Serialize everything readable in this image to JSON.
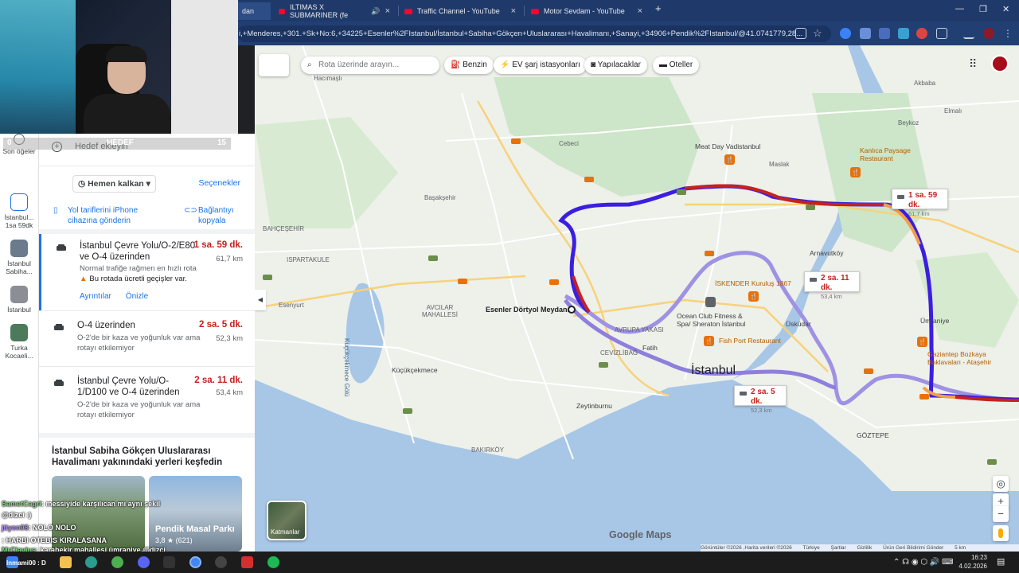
{
  "browser": {
    "tabs": [
      {
        "title": "ILTIMAS X SUBMARINER (fe"
      },
      {
        "title": "Traffic Channel - YouTube"
      },
      {
        "title": "Motor Sevdam - YouTube"
      }
    ],
    "partial_tab": "dan",
    "new_tab": "+",
    "url": "i,+Menderes,+301.+Sk+No:6,+34225+Esenler%2FIstanbul/İstanbul+Sabiha+Gökçen+Uluslararası+Havalimanı,+Sanayi,+34906+Pendik%2FIstanbul/@41.0741779,28..."
  },
  "webcam_bar": {
    "left": "0",
    "center": "HEDEF",
    "right": "15"
  },
  "rail": {
    "items": [
      {
        "label": "Son öğeler"
      },
      {
        "label": "İstanbul... 1sa 59dk"
      },
      {
        "label": "İstanbul Sabiha..."
      },
      {
        "label": "İstanbul"
      },
      {
        "label": "Turka Kocaeli..."
      }
    ]
  },
  "panel": {
    "add_destination": "Hedef ekleyin",
    "leave_now": "Hemen kalkan",
    "options": "Seçenekler",
    "send_to_phone": "Yol tariflerini iPhone cihazına gönderin",
    "copy_link": "Bağlantıyı kopyala",
    "routes": [
      {
        "name": "İstanbul Çevre Yolu/O-2/E80 ve O-4 üzerinden",
        "time": "1 sa. 59 dk.",
        "distance": "61,7 km",
        "desc": "Normal trafiğe rağmen en hızlı rota",
        "warning": "Bu rotada ücretli geçişler var.",
        "details": "Ayrıntılar",
        "preview": "Önizle"
      },
      {
        "name": "O-4 üzerinden",
        "time": "2 sa. 5 dk.",
        "distance": "52,3 km",
        "desc": "O-2'de bir kaza ve yoğunluk var ama rotayı etkilemiyor"
      },
      {
        "name": "İstanbul Çevre Yolu/O-1/D100 ve O-4 üzerinden",
        "time": "2 sa. 11 dk.",
        "distance": "53,4 km",
        "desc": "O-2'de bir kaza ve yoğunluk var ama rotayı etkilemiyor"
      }
    ],
    "explore_title": "İstanbul Sabiha Gökçen Uluslararası Havalimanı yakınındaki yerleri keşfedin",
    "cards": [
      {
        "name": "",
        "rating": ""
      },
      {
        "name": "Pendik Masal Parkı",
        "rating": "3,8 ★ (621)"
      }
    ]
  },
  "chat": {
    "lines": [
      {
        "user": "SametCagri",
        "text": ": messiyide karşılıcan mı aynı şekil"
      },
      {
        "user": "",
        "text": "@dizci :)"
      },
      {
        "user": "jüyen08",
        "text": ": NOLO NOLO"
      },
      {
        "user": "",
        "text": ": HARBI OTEBIS KIRALASANA"
      },
      {
        "user": "MrCiayius",
        "text": ": karabekir mahallesi ümraniye @dizci"
      },
      {
        "user": "",
        "text": "Inmami00 : D"
      }
    ]
  },
  "map": {
    "search_placeholder": "Rota üzerinde arayın...",
    "chips": [
      "Benzin",
      "EV şarj istasyonları",
      "Yapılacaklar",
      "Oteller"
    ],
    "layers_label": "Katmanlar",
    "city": "İstanbul",
    "origin": "Esenler Dörtyol Meydanı",
    "labels": [
      "Hacımaşlı",
      "Cebeci",
      "Başakşehir",
      "BAHÇEŞEHİR",
      "ISPARTAKULE",
      "Esenyurt",
      "AVCILAR MAHALLESİ",
      "Küçükçekmece Gölü",
      "Küçükçekmece",
      "BAKIRKÖY",
      "Zeytinburnu",
      "Fatih",
      "AVRUPA YAKASI",
      "CEVİZLİBAĞ",
      "Arnavutköy",
      "Üsküdar",
      "Ümraniye",
      "Beykoz",
      "Elmalı",
      "Akbaba",
      "Maslak",
      "GÖZTEPE",
      "Kanlıca Paysage Restaurant",
      "Meat Day Vadistanbul",
      "İSKENDER Kuruluş 1867",
      "Ocean Club Fitness & Spa/ Sheraton İstanbul",
      "Fish Port Restaurant",
      "Gaziantep Bozkaya Baklavaları - Ataşehir"
    ],
    "travel_boxes": [
      {
        "time": "1 sa. 59 dk.",
        "distance": "61,7 km"
      },
      {
        "time": "2 sa. 11 dk.",
        "distance": "53,4 km"
      },
      {
        "time": "2 sa. 5 dk.",
        "distance": "52,3 km"
      }
    ],
    "logo": "Google Maps",
    "attribution": [
      "Görüntüler ©2026 ,Harita verileri ©2026",
      "Türkiye",
      "Şartlar",
      "Gizlilik",
      "Ürün Geri Bildirimi Gönder",
      "5 km"
    ]
  },
  "taskbar": {
    "time": "16:23",
    "date": "4.02.2026"
  },
  "colors": {
    "route_primary": "#3c1ee0",
    "route_alt": "#7a6bd8",
    "traffic_red": "#c5221f",
    "traffic_orange": "#f29e4c",
    "accent": "#1a73e8"
  }
}
